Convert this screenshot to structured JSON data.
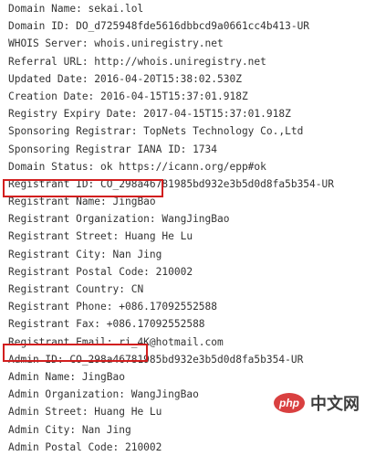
{
  "whois": {
    "lines": [
      "Domain Name: sekai.lol",
      "Domain ID: DO_d725948fde5616dbbcd9a0661cc4b413-UR",
      "WHOIS Server: whois.uniregistry.net",
      "Referral URL: http://whois.uniregistry.net",
      "Updated Date: 2016-04-20T15:38:02.530Z",
      "Creation Date: 2016-04-15T15:37:01.918Z",
      "Registry Expiry Date: 2017-04-15T15:37:01.918Z",
      "Sponsoring Registrar: TopNets Technology Co.,Ltd",
      "Sponsoring Registrar IANA ID: 1734",
      "Domain Status: ok https://icann.org/epp#ok",
      "Registrant ID: CO_298a46781985bd932e3b5d0d8fa5b354-UR",
      "Registrant Name: JingBao",
      "Registrant Organization: WangJingBao",
      "Registrant Street: Huang He Lu",
      "Registrant City: Nan Jing",
      "Registrant Postal Code: 210002",
      "Registrant Country: CN",
      "Registrant Phone: +086.17092552588",
      "Registrant Fax: +086.17092552588",
      "Registrant Email: ri_4K@hotmail.com",
      "Admin ID: CO_298a46781985bd932e3b5d0d8fa5b354-UR",
      "Admin Name: JingBao",
      "Admin Organization: WangJingBao",
      "Admin Street: Huang He Lu",
      "Admin City: Nan Jing",
      "Admin Postal Code: 210002"
    ]
  },
  "highlights": {
    "color": "#d21e1e"
  },
  "watermark": {
    "badge": "php",
    "text": "中文网"
  }
}
